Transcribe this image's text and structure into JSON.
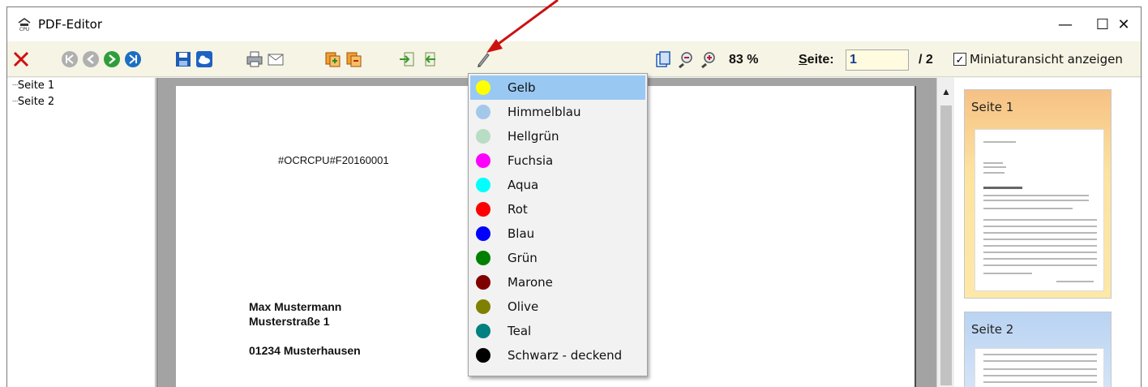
{
  "window": {
    "title": "PDF-Editor",
    "minimize": "—",
    "maximize": "☐",
    "close": "✕"
  },
  "toolbar": {
    "zoom": "83 %",
    "page_label_prefix": "S",
    "page_label_rest": "eite:",
    "page_value": "1",
    "page_total": "/ 2",
    "thumbnail_checkbox_label": "Miniaturansicht anzeigen",
    "thumbnail_checked": true
  },
  "tree": {
    "items": [
      "Seite 1",
      "Seite 2"
    ]
  },
  "document": {
    "ocr_code": "#OCRCPU#F20160001",
    "address": [
      "Max Mustermann",
      "Musterstraße 1",
      "01234 Musterhausen"
    ]
  },
  "color_menu": {
    "selected": "Gelb",
    "items": [
      {
        "label": "Gelb",
        "color": "#ffff00"
      },
      {
        "label": "Himmelblau",
        "color": "#a4c8ea"
      },
      {
        "label": "Hellgrün",
        "color": "#b9dcc4"
      },
      {
        "label": "Fuchsia",
        "color": "#ff00ff"
      },
      {
        "label": "Aqua",
        "color": "#00ffff"
      },
      {
        "label": "Rot",
        "color": "#ff0000"
      },
      {
        "label": "Blau",
        "color": "#0000ff"
      },
      {
        "label": "Grün",
        "color": "#008000"
      },
      {
        "label": "Marone",
        "color": "#800000"
      },
      {
        "label": "Olive",
        "color": "#808000"
      },
      {
        "label": "Teal",
        "color": "#008080"
      },
      {
        "label": "Schwarz - deckend",
        "color": "#000000"
      }
    ]
  },
  "thumbnails": {
    "cards": [
      "Seite 1",
      "Seite 2"
    ]
  },
  "colors": {
    "annotation_arrow": "#cc1111",
    "toolbar_bg": "#f6f4e4",
    "menu_selection": "#99c9f3"
  }
}
